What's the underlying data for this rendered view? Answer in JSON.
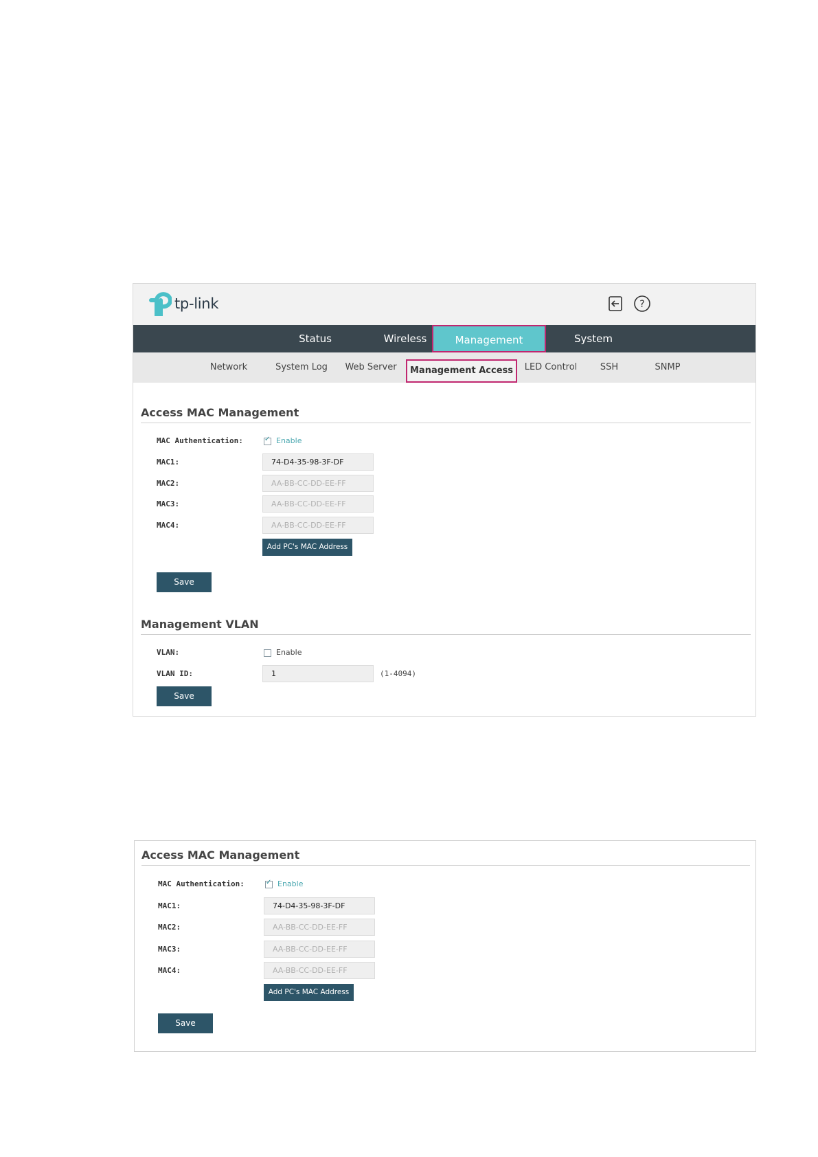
{
  "app": {
    "logo_text": "tp-link",
    "icons": {
      "logout": "logout-icon",
      "help": "help-icon",
      "brand": "tp-link-logo-mark"
    },
    "colors": {
      "nav_bg": "#3a474f",
      "nav_active": "#5fc6cc",
      "highlight": "#c0266f",
      "button": "#2d5568",
      "subnav_bg": "#e8e8e8"
    }
  },
  "nav": {
    "tabs": [
      {
        "label": "Status"
      },
      {
        "label": "Wireless"
      },
      {
        "label": "Management",
        "active": true
      },
      {
        "label": "System"
      }
    ]
  },
  "subnav": {
    "items": [
      {
        "label": "Network"
      },
      {
        "label": "System Log"
      },
      {
        "label": "Web Server"
      },
      {
        "label": "Management Access",
        "active": true
      },
      {
        "label": "LED Control"
      },
      {
        "label": "SSH"
      },
      {
        "label": "SNMP"
      }
    ]
  },
  "access_mac": {
    "title": "Access MAC Management",
    "auth_label": "MAC Authentication:",
    "auth_checked": true,
    "auth_option": "Enable",
    "macs": [
      {
        "label": "MAC1:",
        "value": "74-D4-35-98-3F-DF",
        "placeholder": ""
      },
      {
        "label": "MAC2:",
        "value": "",
        "placeholder": "AA-BB-CC-DD-EE-FF"
      },
      {
        "label": "MAC3:",
        "value": "",
        "placeholder": "AA-BB-CC-DD-EE-FF"
      },
      {
        "label": "MAC4:",
        "value": "",
        "placeholder": "AA-BB-CC-DD-EE-FF"
      }
    ],
    "add_button": "Add PC's MAC Address",
    "save_button": "Save"
  },
  "mgmt_vlan": {
    "title": "Management VLAN",
    "vlan_label": "VLAN:",
    "vlan_checked": false,
    "vlan_option": "Enable",
    "vlan_id_label": "VLAN ID:",
    "vlan_id_value": "1",
    "vlan_id_hint": "(1-4094)",
    "save_button": "Save"
  }
}
